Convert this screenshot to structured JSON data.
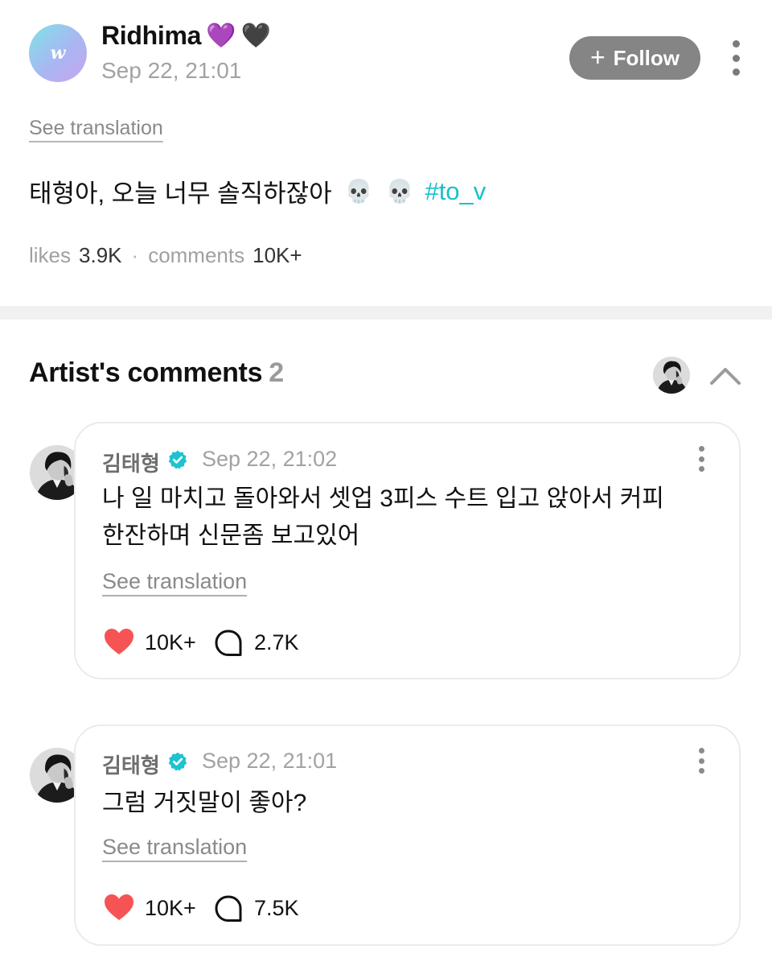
{
  "post": {
    "avatar_letter": "w",
    "author": "Ridhima",
    "author_emojis": [
      "💜",
      "🖤"
    ],
    "date": "Sep 22, 21:01",
    "follow_label": "Follow",
    "see_translation": "See translation",
    "text": "태형아, 오늘 너무 솔직하잖아",
    "text_emojis": [
      "💀",
      "💀"
    ],
    "hashtag": "#to_v",
    "likes_label": "likes",
    "likes_value": "3.9K",
    "comments_label": "comments",
    "comments_value": "10K+"
  },
  "artist_comments": {
    "title": "Artist's comments",
    "count": "2",
    "items": [
      {
        "name": "김태형",
        "date": "Sep 22, 21:02",
        "lines": [
          "나 일 마치고 돌아와서 셋업 3피스 수트 입고 앉아서 커피",
          "한잔하며 신문좀 보고있어"
        ],
        "see_translation": "See translation",
        "likes": "10K+",
        "replies": "2.7K"
      },
      {
        "name": "김태형",
        "date": "Sep 22, 21:01",
        "lines": [
          "그럼 거짓말이 좋아?"
        ],
        "see_translation": "See translation",
        "likes": "10K+",
        "replies": "7.5K"
      }
    ]
  },
  "colors": {
    "hashtag": "#17c0cf",
    "verified": "#1fc2cf",
    "heart": "#f65454",
    "follow_button": "#858585",
    "divider": "#f1f1f1"
  },
  "icons": {
    "follow_plus": "+",
    "verified": "verified-badge-icon",
    "heart": "heart-icon",
    "reply": "comment-bubble-icon",
    "more": "more-vertical-icon",
    "collapse": "chevron-up-icon"
  }
}
